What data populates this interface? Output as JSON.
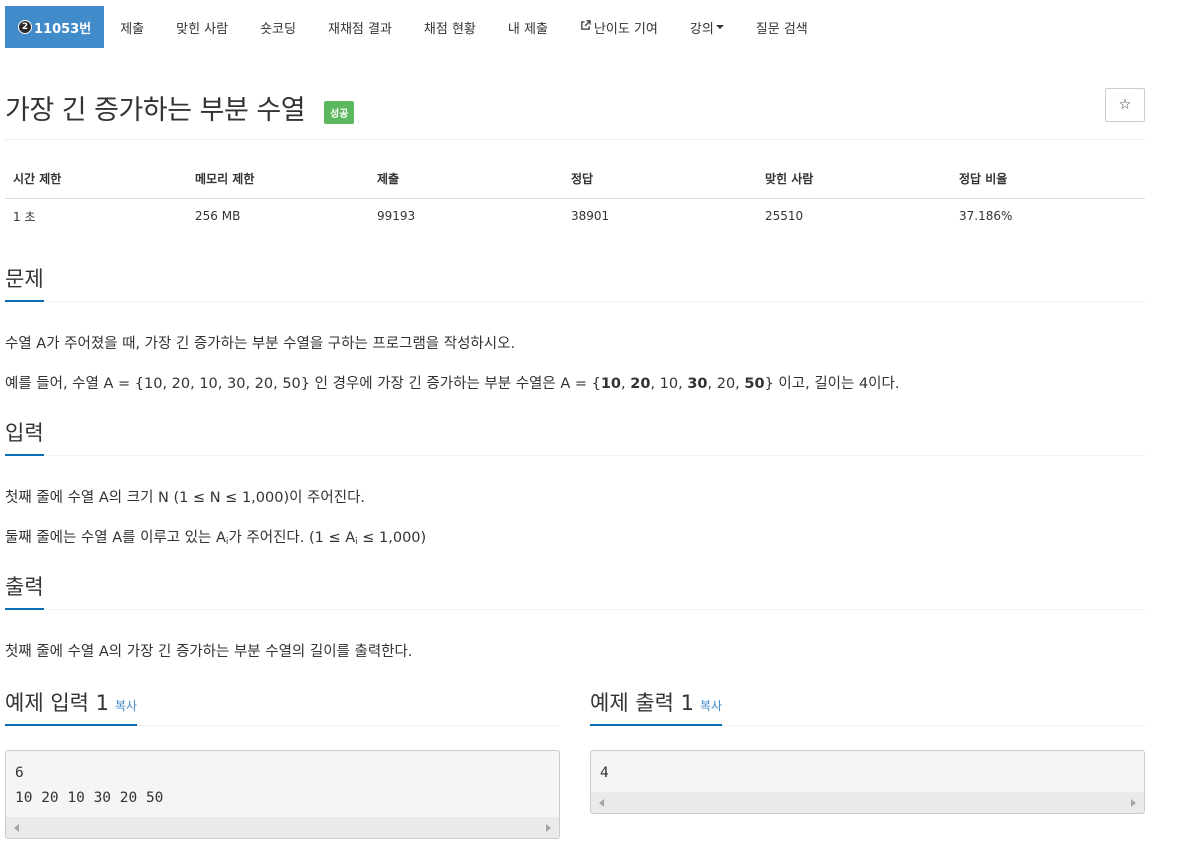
{
  "nav": {
    "problem_id": "11053번",
    "tier_mark": "2",
    "items": [
      "제출",
      "맞힌 사람",
      "숏코딩",
      "재채점 결과",
      "채점 현황",
      "내 제출",
      "난이도 기여",
      "강의",
      "질문 검색"
    ]
  },
  "problem": {
    "title": "가장 긴 증가하는 부분 수열",
    "status": "성공",
    "star": "☆"
  },
  "info": {
    "headers": [
      "시간 제한",
      "메모리 제한",
      "제출",
      "정답",
      "맞힌 사람",
      "정답 비율"
    ],
    "values": [
      "1 초",
      "256 MB",
      "99193",
      "38901",
      "25510",
      "37.186%"
    ]
  },
  "sections": {
    "problem_title": "문제",
    "problem_p1": "수열 A가 주어졌을 때, 가장 긴 증가하는 부분 수열을 구하는 프로그램을 작성하시오.",
    "problem_p2": {
      "a": "예를 들어, 수열 A = {10, 20, 10, 30, 20, 50} 인 경우에 가장 긴 증가하는 부분 수열은 A = {",
      "b1": "10",
      "c1": ", ",
      "b2": "20",
      "c2": ", 10, ",
      "b3": "30",
      "c3": ", 20, ",
      "b4": "50",
      "d": "} 이고, 길이는 4이다."
    },
    "input_title": "입력",
    "input_p1": "첫째 줄에 수열 A의 크기 N (1 ≤ N ≤ 1,000)이 주어진다.",
    "input_p2": {
      "a": "둘째 줄에는 수열 A를 이루고 있는 A",
      "sub1": "i",
      "b": "가 주어진다. (1 ≤ A",
      "sub2": "i",
      "c": " ≤ 1,000)"
    },
    "output_title": "출력",
    "output_p1": "첫째 줄에 수열 A의 가장 긴 증가하는 부분 수열의 길이를 출력한다."
  },
  "samples": {
    "input_title": "예제 입력 1",
    "output_title": "예제 출력 1",
    "copy_label": "복사",
    "input_text": "6\n10 20 10 30 20 50",
    "output_text": "4"
  },
  "colors": {
    "nav_active": "#428bca",
    "badge_success": "#5cb85c",
    "section_underline": "#0a6cb3"
  }
}
